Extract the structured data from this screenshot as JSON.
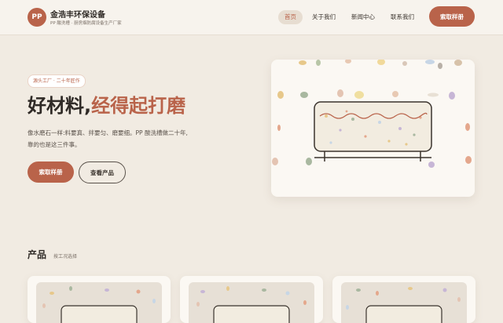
{
  "header": {
    "logo_text": "PP",
    "brand_name": "金浩丰环保设备",
    "brand_sub": "PP 酸洗槽 · 厨房烟防腐设备生产厂家",
    "nav": [
      {
        "label": "首页",
        "active": true
      },
      {
        "label": "关于我们",
        "active": false
      },
      {
        "label": "新闻中心",
        "active": false
      },
      {
        "label": "联系我们",
        "active": false
      }
    ],
    "cta_label": "索取样册"
  },
  "hero": {
    "tag": "源头工厂 · 二十年匠作",
    "title_part1": "好材料,",
    "title_part2": "经得起打磨",
    "description": "像水磨石一样:料要真、拌要匀、磨要细。PP 酸洗槽做二十年,靠的也是这三件事。",
    "primary_button": "索取样册",
    "secondary_button": "查看产品"
  },
  "products": {
    "title": "产品",
    "subtitle": "按工况选择",
    "items": [
      "product-1",
      "product-2",
      "product-3"
    ]
  },
  "colors": {
    "accent": "#b9634a",
    "background": "#f1ebe2",
    "header_bg": "#f7f3ed",
    "card_bg": "#fbf8f3",
    "text": "#2f2a26"
  },
  "icons": {
    "hero_illustration": "terrazzo-tank-illustration",
    "product_thumbnail": "terrazzo-tank-thumbnail"
  }
}
